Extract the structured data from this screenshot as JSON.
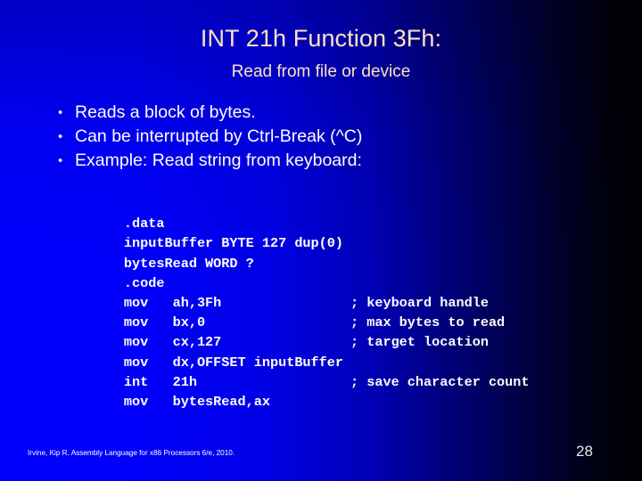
{
  "slide": {
    "title": "INT 21h Function 3Fh:",
    "subtitle": "Read from file or device",
    "bullet_marker": "•",
    "bullets": [
      "Reads a block of bytes.",
      "Can be interrupted by Ctrl-Break (^C)",
      "Example: Read string from keyboard:"
    ],
    "code": [
      {
        "text": ".data",
        "comment": ""
      },
      {
        "text": "inputBuffer BYTE 127 dup(0)",
        "comment": ""
      },
      {
        "text": "bytesRead WORD ?",
        "comment": ""
      },
      {
        "text": ".code",
        "comment": ""
      },
      {
        "text": "mov   ah,3Fh",
        "comment": ""
      },
      {
        "text": "mov   bx,0",
        "comment": "; keyboard handle"
      },
      {
        "text": "mov   cx,127",
        "comment": "; max bytes to read"
      },
      {
        "text": "mov   dx,OFFSET inputBuffer",
        "comment": "; target location"
      },
      {
        "text": "int   21h",
        "comment": ""
      },
      {
        "text": "mov   bytesRead,ax",
        "comment": "; save character count"
      }
    ],
    "footer_credit": "Irvine, Kip R. Assembly Language for x86 Processors 6/e, 2010.",
    "page_number": "28",
    "colors": {
      "background_left": "#0000FF",
      "background_right": "#000004",
      "title_text": "#FFE2C4",
      "body_text": "#FFFFFF",
      "page_number_text": "#E8E8F0"
    }
  }
}
